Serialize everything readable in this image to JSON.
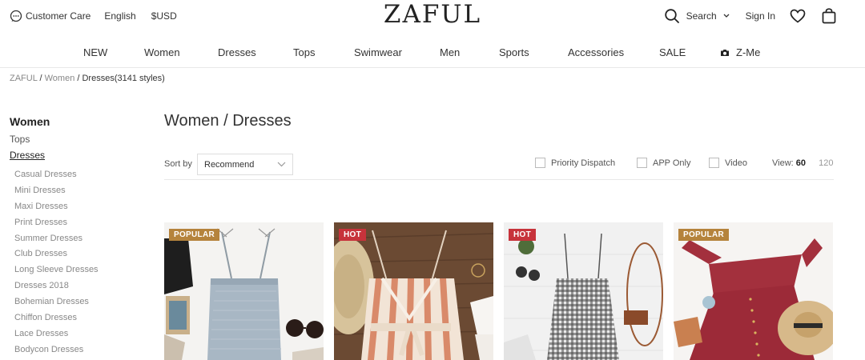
{
  "header": {
    "customer_care": "Customer Care",
    "language": "English",
    "currency": "$USD",
    "logo": "ZAFUL",
    "search": "Search",
    "sign_in": "Sign In"
  },
  "nav": {
    "items": [
      "NEW",
      "Women",
      "Dresses",
      "Tops",
      "Swimwear",
      "Men",
      "Sports",
      "Accessories",
      "SALE",
      "Z-Me"
    ]
  },
  "breadcrumb": {
    "root": "ZAFUL",
    "sep": " / ",
    "level1": "Women",
    "current": "Dresses(3141 styles)"
  },
  "sidebar": {
    "title": "Women",
    "links": [
      "Tops",
      "Dresses"
    ],
    "subcategories": [
      "Casual Dresses",
      "Mini Dresses",
      "Maxi Dresses",
      "Print Dresses",
      "Summer Dresses",
      "Club Dresses",
      "Long Sleeve Dresses",
      "Dresses 2018",
      "Bohemian Dresses",
      "Chiffon Dresses",
      "Lace Dresses",
      "Bodycon Dresses"
    ]
  },
  "main": {
    "title": "Women / Dresses",
    "sort_label": "Sort by",
    "sort_value": "Recommend",
    "filters": [
      "Priority Dispatch",
      "APP Only",
      "Video"
    ],
    "view_label": "View:",
    "view_selected": "60",
    "view_alt": "120"
  },
  "products": [
    {
      "badge": "POPULAR",
      "badge_type": "popular"
    },
    {
      "badge": "HOT",
      "badge_type": "hot"
    },
    {
      "badge": "HOT",
      "badge_type": "hot"
    },
    {
      "badge": "POPULAR",
      "badge_type": "popular"
    }
  ],
  "colors": {
    "popular_badge": "#b5833c",
    "hot_badge": "#c7333b"
  }
}
